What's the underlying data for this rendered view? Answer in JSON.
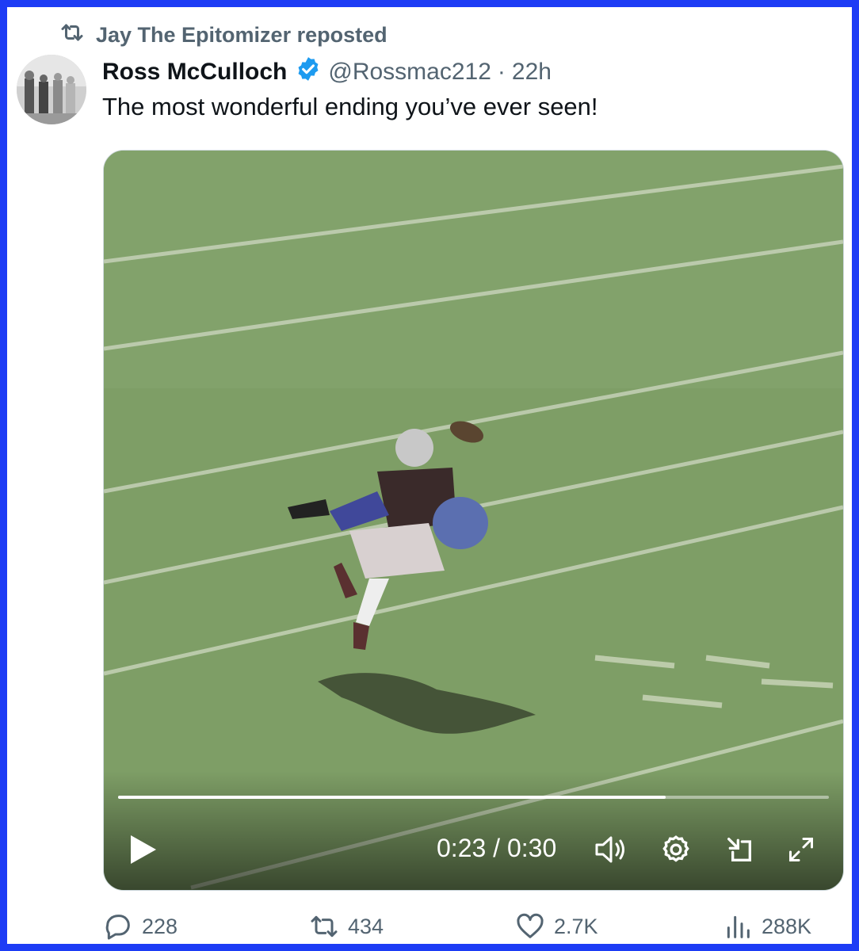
{
  "repost": {
    "text": "Jay The Epitomizer reposted",
    "icon": "repost-icon"
  },
  "author": {
    "display_name": "Ross McCulloch",
    "verified_icon": "verified-badge-icon",
    "handle": "@Rossmac212",
    "separator": "·",
    "time": "22h"
  },
  "tweet": {
    "text": "The most wonderful ending you’ve ever seen!"
  },
  "video": {
    "time_readout": "0:23 / 0:30",
    "progress": 0.77,
    "controls": [
      "play-icon",
      "volume-icon",
      "settings-icon",
      "picture-in-picture-icon",
      "fullscreen-icon"
    ]
  },
  "actions": {
    "replies": "228",
    "reposts": "434",
    "likes": "2.7K",
    "views": "288K"
  },
  "colors": {
    "border": "#1d3cf5",
    "verified": "#1d9bf0",
    "muted_text": "#536471",
    "field": "#7e9e66"
  }
}
